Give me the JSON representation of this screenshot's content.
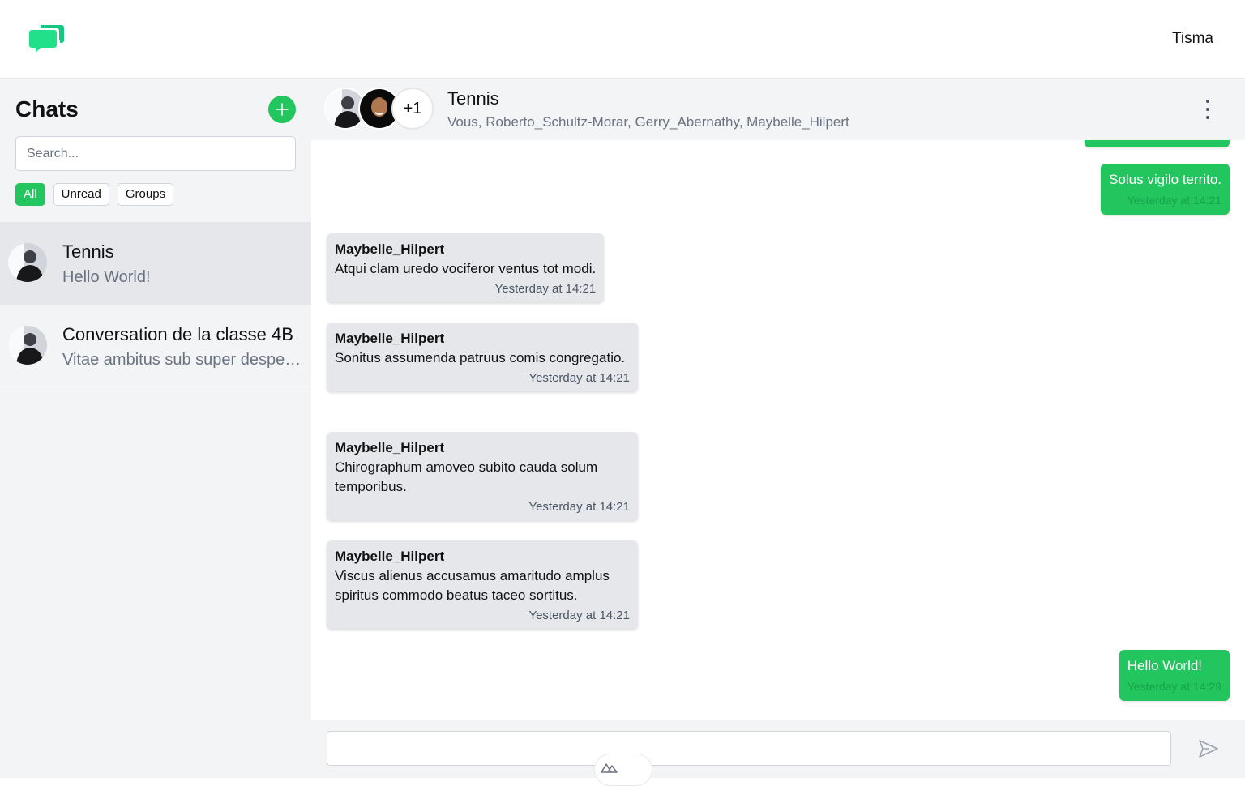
{
  "topbar": {
    "username": "Tisma",
    "logo_icon": "chat-bubbles-icon",
    "accent": "#22c55e"
  },
  "sidebar": {
    "title": "Chats",
    "new_chat_icon": "plus-icon",
    "search_placeholder": "Search...",
    "filters": [
      "All",
      "Unread",
      "Groups"
    ],
    "active_filter": "All",
    "conversations": [
      {
        "name": "Tennis",
        "preview": "Hello World!",
        "selected": true
      },
      {
        "name": "Conversation de la classe 4B",
        "preview": "Vitae ambitus sub super despectus.",
        "selected": false
      }
    ]
  },
  "chat": {
    "title": "Tennis",
    "extra_members": "+1",
    "members": "Vous, Roberto_Schultz-Morar, Gerry_Abernathy, Maybelle_Hilpert",
    "menu_icon": "kebab-menu-icon",
    "messages": [
      {
        "dir": "out",
        "text": "Solus vigilo territo.",
        "time": "Yesterday at 14:21"
      },
      {
        "dir": "in",
        "sender": "Maybelle_Hilpert",
        "text": "Atqui clam uredo vociferor ventus tot modi.",
        "time": "Yesterday at 14:21"
      },
      {
        "dir": "in",
        "sender": "Maybelle_Hilpert",
        "text": "Sonitus assumenda patruus comis congregatio.",
        "time": "Yesterday at 14:21"
      },
      {
        "dir": "in",
        "sender": "Maybelle_Hilpert",
        "text": "Chirographum amoveo subito cauda solum temporibus.",
        "time": "Yesterday at 14:21"
      },
      {
        "dir": "in",
        "sender": "Maybelle_Hilpert",
        "text": "Viscus alienus accusamus amaritudo amplus spiritus commodo beatus taceo sortitus.",
        "time": "Yesterday at 14:21"
      },
      {
        "dir": "out",
        "text": "Hello World!",
        "time": "Yesterday at 14:29"
      }
    ]
  },
  "composer": {
    "value": "",
    "send_icon": "send-icon"
  }
}
